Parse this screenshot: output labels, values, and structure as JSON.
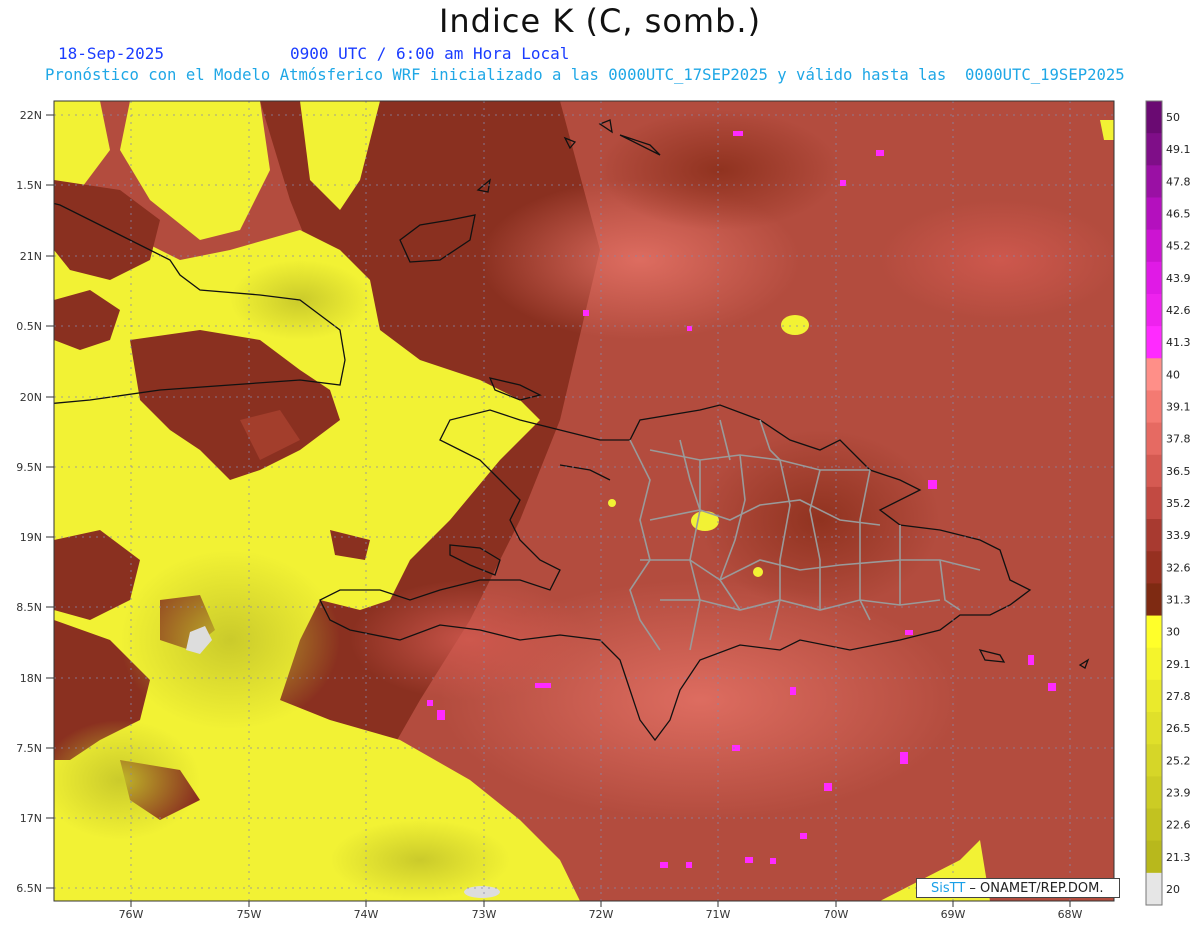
{
  "header": {
    "title": "Indice K (C, somb.)",
    "date": "18-Sep-2025",
    "time": "0900 UTC / 6:00 am Hora Local",
    "forecast_info": "Pronóstico con el Modelo Atmósferico WRF inicializado a las 0000UTC_17SEP2025 y válido hasta las  0000UTC_19SEP2025"
  },
  "axes": {
    "lat_labels": [
      "22N",
      "1.5N",
      "21N",
      "0.5N",
      "20N",
      "9.5N",
      "19N",
      "8.5N",
      "18N",
      "7.5N",
      "17N",
      "6.5N"
    ],
    "lon_labels": [
      "76W",
      "75W",
      "74W",
      "73W",
      "72W",
      "71W",
      "70W",
      "69W",
      "68W"
    ]
  },
  "legend": {
    "labels": [
      "50",
      "49.1",
      "47.8",
      "46.5",
      "45.2",
      "43.9",
      "42.6",
      "41.3",
      "40",
      "39.1",
      "37.8",
      "36.5",
      "35.2",
      "33.9",
      "32.6",
      "31.3",
      "30",
      "29.1",
      "27.8",
      "26.5",
      "25.2",
      "23.9",
      "22.6",
      "21.3",
      "20"
    ],
    "colors": [
      "#6a0a72",
      "#7f0e88",
      "#9a10a4",
      "#b410be",
      "#cc14d2",
      "#e01ae6",
      "#ee22ee",
      "#ff2aff",
      "#ff8f88",
      "#f47a72",
      "#e66a62",
      "#d55a52",
      "#c24a42",
      "#a83a30",
      "#963020",
      "#7e2a12",
      "#ffff2a",
      "#f4f42c",
      "#eaea2c",
      "#e0e02a",
      "#d6d628",
      "#cccc24",
      "#c2c220",
      "#b8b81c",
      "#e6e6e6"
    ]
  },
  "credit": {
    "sis": "SisTT",
    "org": " – ONAMET/REP.DOM."
  }
}
